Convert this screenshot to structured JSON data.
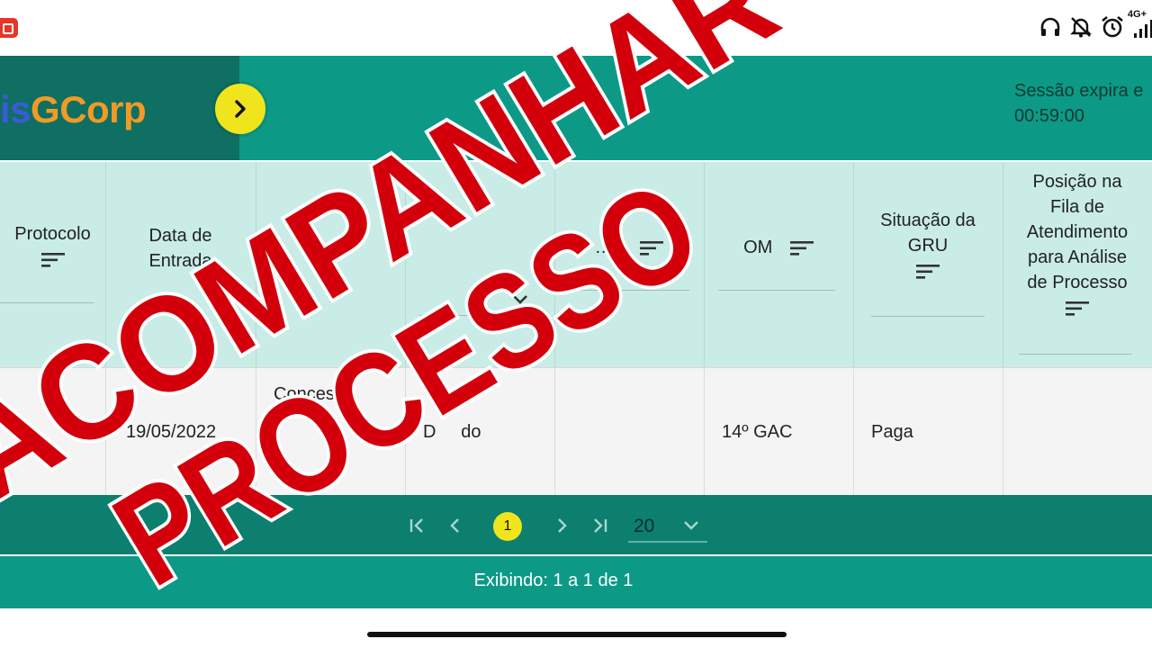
{
  "status_bar": {
    "network_label": "4G+",
    "icons": [
      "record-icon",
      "headphones-icon",
      "bell-off-icon",
      "alarm-icon",
      "signal-icon"
    ]
  },
  "header": {
    "logo_part1": "is",
    "logo_part2": "GCorp",
    "session_line1": "Sessão expira e",
    "session_line2": "00:59:00"
  },
  "table": {
    "columns": [
      {
        "label": "Protocolo"
      },
      {
        "label": "Data de Entrada"
      },
      {
        "label": ""
      },
      {
        "label": ""
      },
      {
        "label": "…o"
      },
      {
        "label": "OM"
      },
      {
        "label": "Situação da GRU"
      },
      {
        "label": "Posição na Fila de Atendimento para Análise de Processo"
      }
    ],
    "row": {
      "protocolo": "",
      "data_entrada": "19/05/2022",
      "col3": "Concess",
      "col4": "D     do",
      "col5": "",
      "om": "14º GAC",
      "situacao_gru": "Paga",
      "posicao": ""
    }
  },
  "paginator": {
    "current_page": "1",
    "page_size": "20"
  },
  "footer": {
    "showing": "Exibindo: 1 a 1 de 1"
  },
  "overlay": {
    "line1": "ACOMPANHAR",
    "line2": "PROCESSO"
  },
  "colors": {
    "header_teal": "#0c9a86",
    "header_dark": "#0f6f62",
    "table_head": "#c9ece6",
    "accent_yellow": "#f0e41d",
    "overlay_red": "#d3000c"
  }
}
